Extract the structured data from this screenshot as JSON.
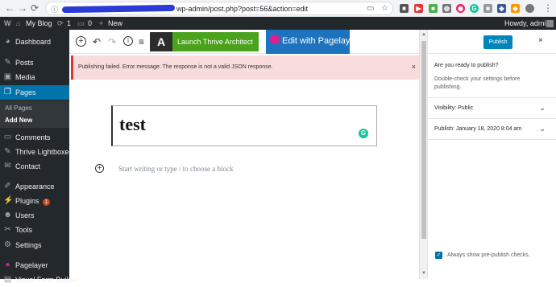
{
  "browser": {
    "url_suffix": "wp-admin/post.php?post=56&action=edit"
  },
  "adminbar": {
    "wp_logo": "W",
    "site_name": "My Blog",
    "updates_count": "1",
    "comments_count": "0",
    "new_label": "New",
    "greeting": "Howdy, admin"
  },
  "sidebar": {
    "items": [
      {
        "label": "Dashboard",
        "icon": "dashboard-icon"
      },
      {
        "label": "Posts",
        "icon": "pin-icon"
      },
      {
        "label": "Media",
        "icon": "media-icon"
      },
      {
        "label": "Pages",
        "icon": "pages-icon"
      },
      {
        "label": "Comments",
        "icon": "comment-icon"
      },
      {
        "label": "Thrive Lightboxes",
        "icon": "pin-icon"
      },
      {
        "label": "Contact",
        "icon": "envelope-icon"
      },
      {
        "label": "Appearance",
        "icon": "brush-icon"
      },
      {
        "label": "Plugins",
        "icon": "plug-icon"
      },
      {
        "label": "Users",
        "icon": "user-icon"
      },
      {
        "label": "Tools",
        "icon": "wrench-icon"
      },
      {
        "label": "Settings",
        "icon": "settings-icon"
      },
      {
        "label": "Pagelayer",
        "icon": "pagelayer-icon"
      },
      {
        "label": "Visual Form Builder",
        "icon": "form-icon"
      }
    ],
    "plugins_badge": "1",
    "sub_all_pages": "All Pages",
    "sub_add_new": "Add New"
  },
  "toolbar": {
    "thrive_logo": "A",
    "thrive_label": "Launch Thrive Architect",
    "pagelayer_label": "Edit with Pagelayer"
  },
  "notice": {
    "text": "Publishing failed. Error message: The response is not a valid JSON response.",
    "dismiss": "×"
  },
  "editor": {
    "title": "test",
    "grammarly": "G",
    "placeholder": "Start writing or type / to choose a block"
  },
  "panel": {
    "publish_label": "Publish",
    "close": "×",
    "question": "Are you ready to publish?",
    "hint": "Double-check your settings before publishing.",
    "visibility_label": "Visibility:",
    "visibility_value": "Public",
    "publish_when_label": "Publish:",
    "publish_when_value": "January 18, 2020 8:04 am",
    "prepublish_label": "Always show pre-publish checks.",
    "prepublish_checked": true
  },
  "colors": {
    "admin_bg": "#23282d",
    "active_blue": "#0073aa",
    "notice_bg": "#f8dcdc",
    "thrive_green": "#4aa31b",
    "pagelayer_blue": "#1e73be",
    "publish_blue": "#0085ba"
  }
}
